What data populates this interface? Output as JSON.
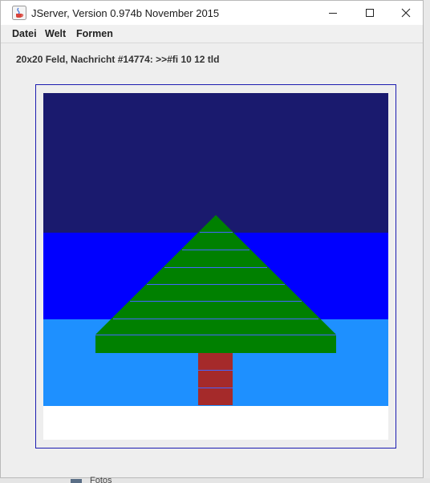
{
  "window": {
    "title": "JServer, Version 0.974b November 2015",
    "app_icon": "java-cup-icon",
    "controls": [
      "minimize-icon",
      "maximize-icon",
      "close-icon"
    ]
  },
  "menu": {
    "items": [
      {
        "label": "Datei"
      },
      {
        "label": "Welt"
      },
      {
        "label": "Formen"
      }
    ]
  },
  "status": {
    "message": "20x20 Feld, Nachricht #14774: >>#fi 10 12 tld"
  },
  "board": {
    "size": "20x20",
    "colors": {
      "sky_dark": "#1a1a6e",
      "sky_blue": "#0000ff",
      "sky_light": "#1e90ff",
      "ground": "#ffffff",
      "tree": "#008000",
      "trunk": "#a52a2a",
      "stripe": "#4466ff",
      "frame": "#1c1cb0"
    }
  },
  "taskbar_peek": {
    "label": "Fotos",
    "icon": "photos-icon"
  }
}
